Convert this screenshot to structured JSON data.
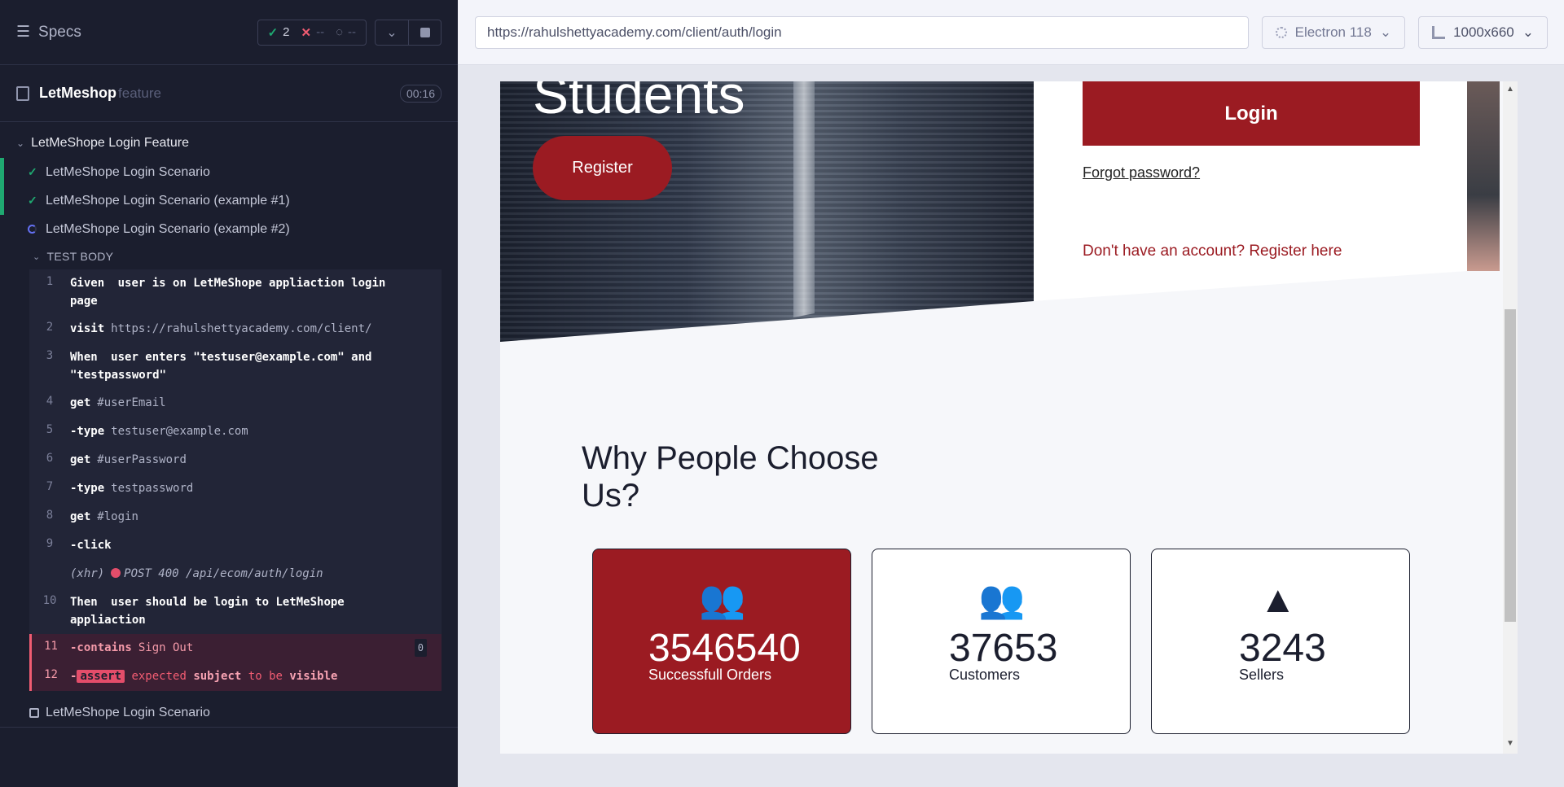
{
  "runner": {
    "specs_label": "Specs",
    "stats": {
      "passed": "2",
      "failed": "--",
      "pending": "--"
    },
    "spec": {
      "name": "LetMeshop",
      "ext": "feature",
      "duration": "00:16"
    },
    "suite_title": "LetMeShope Login Feature",
    "tests": [
      {
        "label": "LetMeShope Login Scenario",
        "state": "passed"
      },
      {
        "label": "LetMeShope Login Scenario (example #1)",
        "state": "passed"
      },
      {
        "label": "LetMeShope Login Scenario (example #2)",
        "state": "running"
      }
    ],
    "test_body_label": "TEST BODY",
    "commands": [
      {
        "num": "1",
        "kw": "Given",
        "arg": "user is on LetMeShope appliaction login",
        "arg2": "page"
      },
      {
        "num": "2",
        "kw": "visit",
        "arg": "https://rahulshettyacademy.com/client/"
      },
      {
        "num": "3",
        "kw": "When",
        "arg": "user enters \"testuser@example.com\" and",
        "arg2": "\"testpassword\""
      },
      {
        "num": "4",
        "kw": "get",
        "arg": "#userEmail"
      },
      {
        "num": "5",
        "kw": "-type",
        "arg": "testuser@example.com"
      },
      {
        "num": "6",
        "kw": "get",
        "arg": "#userPassword"
      },
      {
        "num": "7",
        "kw": "-type",
        "arg": "testpassword"
      },
      {
        "num": "8",
        "kw": "get",
        "arg": "#login"
      },
      {
        "num": "9",
        "kw": "-click",
        "arg": ""
      },
      {
        "num": "",
        "xhr": "(xhr)",
        "xhr_detail": "POST 400 /api/ecom/auth/login"
      },
      {
        "num": "10",
        "kw": "Then",
        "arg": "user should be login to LetMeShope",
        "arg2": "appliaction"
      },
      {
        "num": "11",
        "kw": "-contains",
        "arg": "Sign Out",
        "badge": "0"
      },
      {
        "num": "12",
        "kw": "-",
        "assert": "assert",
        "w1": "expected",
        "w2": "subject",
        "w3": "to be",
        "w4": "visible"
      }
    ],
    "next_test": "LetMeShope Login Scenario"
  },
  "aut": {
    "url": "https://rahulshettyacademy.com/client/auth/login",
    "browser": "Electron 118",
    "viewport": "1000x660",
    "page": {
      "hero_title": "Students",
      "register_label": "Register",
      "login_label": "Login",
      "forgot_label": "Forgot password?",
      "signup_label": "Don't have an account? Register here",
      "why_title": "Why People Choose Us?",
      "cards": [
        {
          "icon": "users-icon",
          "value": "3546540",
          "label": "Successfull Orders",
          "highlight": true
        },
        {
          "icon": "users-icon",
          "value": "37653",
          "label": "Customers",
          "highlight": false
        },
        {
          "icon": "road-icon",
          "value": "3243",
          "label": "Sellers",
          "highlight": false
        }
      ]
    }
  },
  "colors": {
    "runner_bg": "#1b1e2e",
    "pass": "#1fa971",
    "fail": "#f15c72",
    "brand_red": "#9b1b22"
  }
}
